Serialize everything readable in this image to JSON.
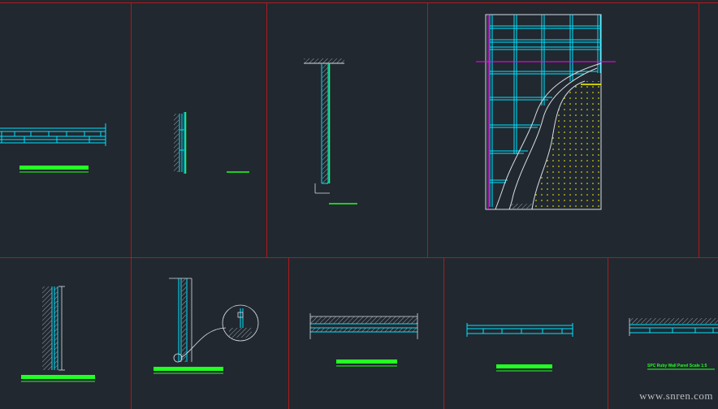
{
  "drawing": {
    "background": "#212830",
    "colors": {
      "frame": "#b01a1a",
      "cyan": "#00e5ff",
      "green": "#22ff22",
      "magenta": "#ff00ff",
      "yellow": "#ffff00",
      "hatch": "#9aa3aa",
      "white": "#d8dde2"
    },
    "panels": [
      {
        "id": "panel-1",
        "content": "horizontal-ceiling-section"
      },
      {
        "id": "panel-2",
        "content": "wall-section-small"
      },
      {
        "id": "panel-3",
        "content": "tall-wall-section"
      },
      {
        "id": "panel-4",
        "content": "elevation-with-cutaway"
      },
      {
        "id": "panel-5",
        "content": "wall-section-hatched"
      },
      {
        "id": "panel-6",
        "content": "wall-section-with-detail-callout"
      },
      {
        "id": "panel-7",
        "content": "floor-section-hatched"
      },
      {
        "id": "panel-8",
        "content": "floor-section-plain"
      },
      {
        "id": "panel-9",
        "content": "floor-section-with-label"
      }
    ],
    "small_label": "SPC Ruby Wall Panel  Scale 1:5",
    "watermark": "www.snren.com"
  }
}
